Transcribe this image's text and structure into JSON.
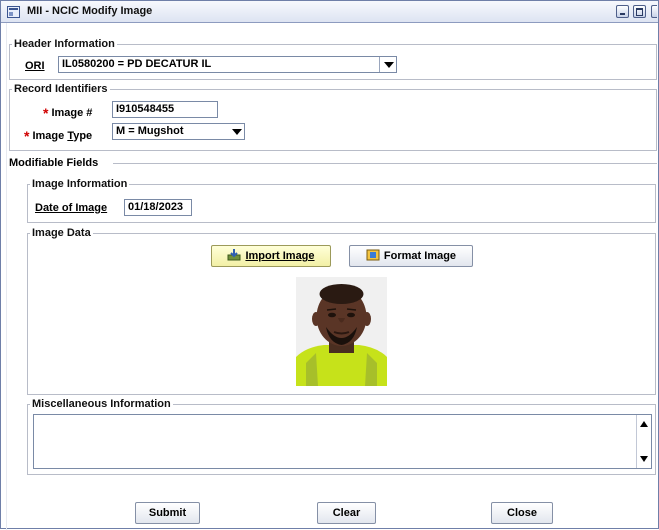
{
  "window": {
    "title": "MII - NCIC Modify Image"
  },
  "header_info": {
    "legend": "Header Information",
    "ori_label": "ORI",
    "ori_value": "IL0580200 = PD DECATUR IL"
  },
  "record_identifiers": {
    "legend": "Record Identifiers",
    "image_num_label": "Image #",
    "image_num_value": "I910548455",
    "image_type_label_pre": "Image ",
    "image_type_label_ul": "T",
    "image_type_label_post": "ype",
    "image_type_value": "M = Mugshot",
    "required_mark": "*"
  },
  "modifiable": {
    "legend": "Modifiable Fields",
    "image_information": {
      "legend": "Image Information",
      "date_label": "Date of Image",
      "date_value": "01/18/2023"
    },
    "image_data": {
      "legend": "Image Data",
      "import_label": "Import Image",
      "format_label": "Format Image"
    },
    "misc": {
      "legend": "Miscellaneous Information",
      "value": ""
    }
  },
  "footer": {
    "submit_label": "Submit",
    "clear_label": "Clear",
    "close_label": "Close"
  },
  "icons": {
    "app": "window-icon",
    "import": "import-icon",
    "format": "format-icon"
  },
  "colors": {
    "required": "#d00000",
    "highlight_button": "#f2f0a6",
    "titlebar": "#dde4f2"
  }
}
